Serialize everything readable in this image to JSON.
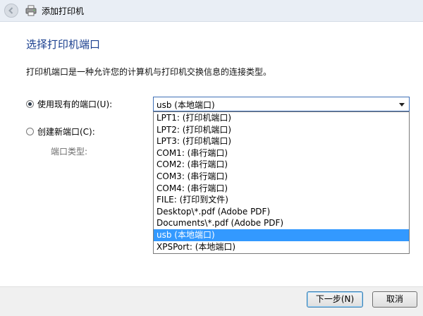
{
  "window": {
    "title": "添加打印机"
  },
  "main": {
    "heading": "选择打印机端口",
    "description": "打印机端口是一种允许您的计算机与打印机交换信息的连接类型。",
    "use_existing_label": "使用现有的端口(U):",
    "create_new_label": "创建新端口(C):",
    "port_type_label": "端口类型:",
    "selected_port": "usb (本地端口)",
    "options": [
      "LPT1: (打印机端口)",
      "LPT2: (打印机端口)",
      "LPT3: (打印机端口)",
      "COM1: (串行端口)",
      "COM2: (串行端口)",
      "COM3: (串行端口)",
      "COM4: (串行端口)",
      "FILE: (打印到文件)",
      "Desktop\\*.pdf (Adobe PDF)",
      "Documents\\*.pdf (Adobe PDF)",
      "usb (本地端口)",
      "XPSPort: (本地端口)"
    ],
    "selected_index": 10
  },
  "footer": {
    "next_label": "下一步(N)",
    "cancel_label": "取消"
  },
  "colors": {
    "heading": "#1a3f8f",
    "selection": "#3399ff"
  }
}
